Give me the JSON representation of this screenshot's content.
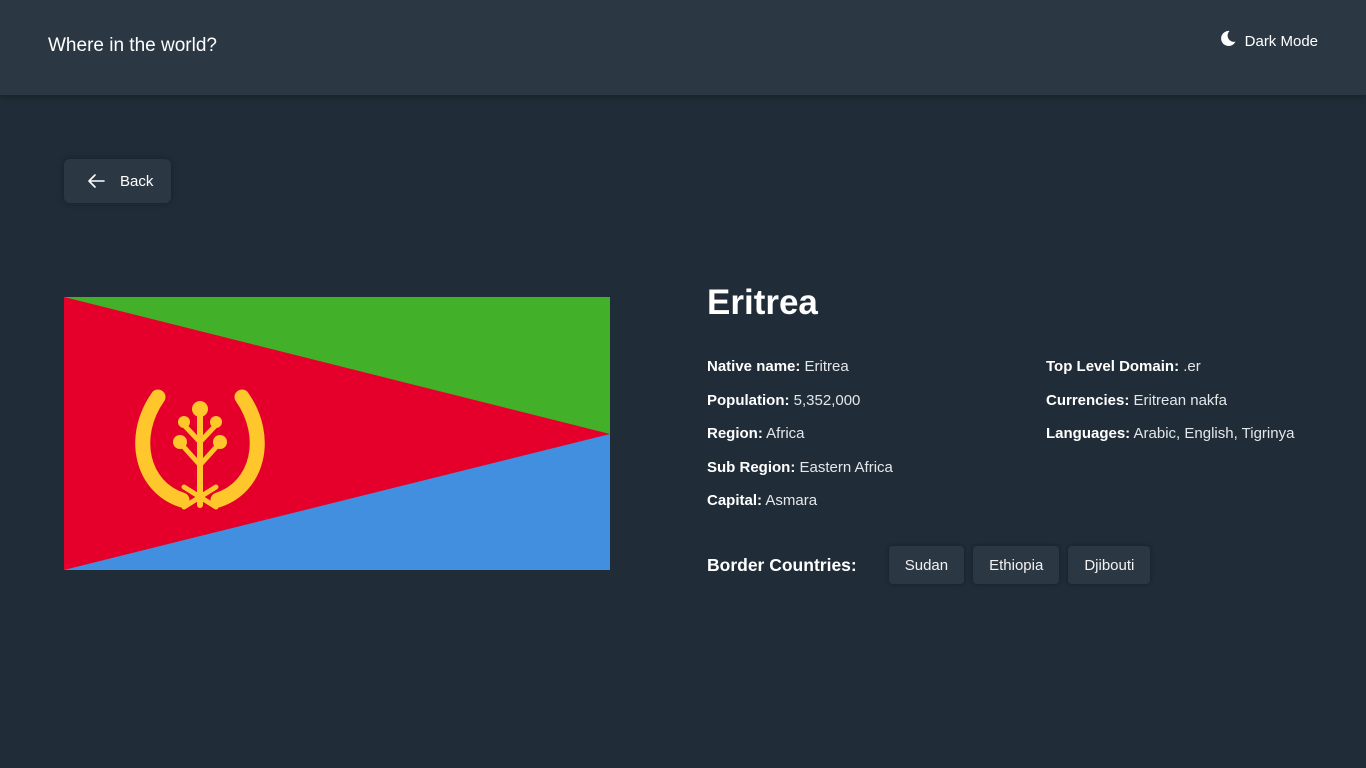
{
  "header": {
    "title": "Where in the world?",
    "theme_toggle_label": "Dark Mode",
    "theme_icon": "moon-icon"
  },
  "back_button": {
    "label": "Back",
    "icon": "arrow-left-icon"
  },
  "country": {
    "name": "Eritrea",
    "flag": {
      "colors": {
        "green": "#43b02a",
        "red": "#e4002b",
        "blue": "#418fde",
        "emblem": "#ffc72c"
      }
    },
    "details_left": [
      {
        "label": "Native name:",
        "value": "Eritrea"
      },
      {
        "label": "Population:",
        "value": "5,352,000"
      },
      {
        "label": "Region:",
        "value": "Africa"
      },
      {
        "label": "Sub Region:",
        "value": "Eastern Africa"
      },
      {
        "label": "Capital:",
        "value": "Asmara"
      }
    ],
    "details_right": [
      {
        "label": "Top Level Domain:",
        "value": ".er"
      },
      {
        "label": "Currencies:",
        "value": "Eritrean nakfa"
      },
      {
        "label": "Languages:",
        "value": "Arabic, English, Tigrinya"
      }
    ],
    "border_label": "Border Countries:",
    "borders": [
      "Sudan",
      "Ethiopia",
      "Djibouti"
    ]
  },
  "theme": {
    "background": "#202c37",
    "elements": "#2b3844",
    "text": "#ffffff"
  }
}
